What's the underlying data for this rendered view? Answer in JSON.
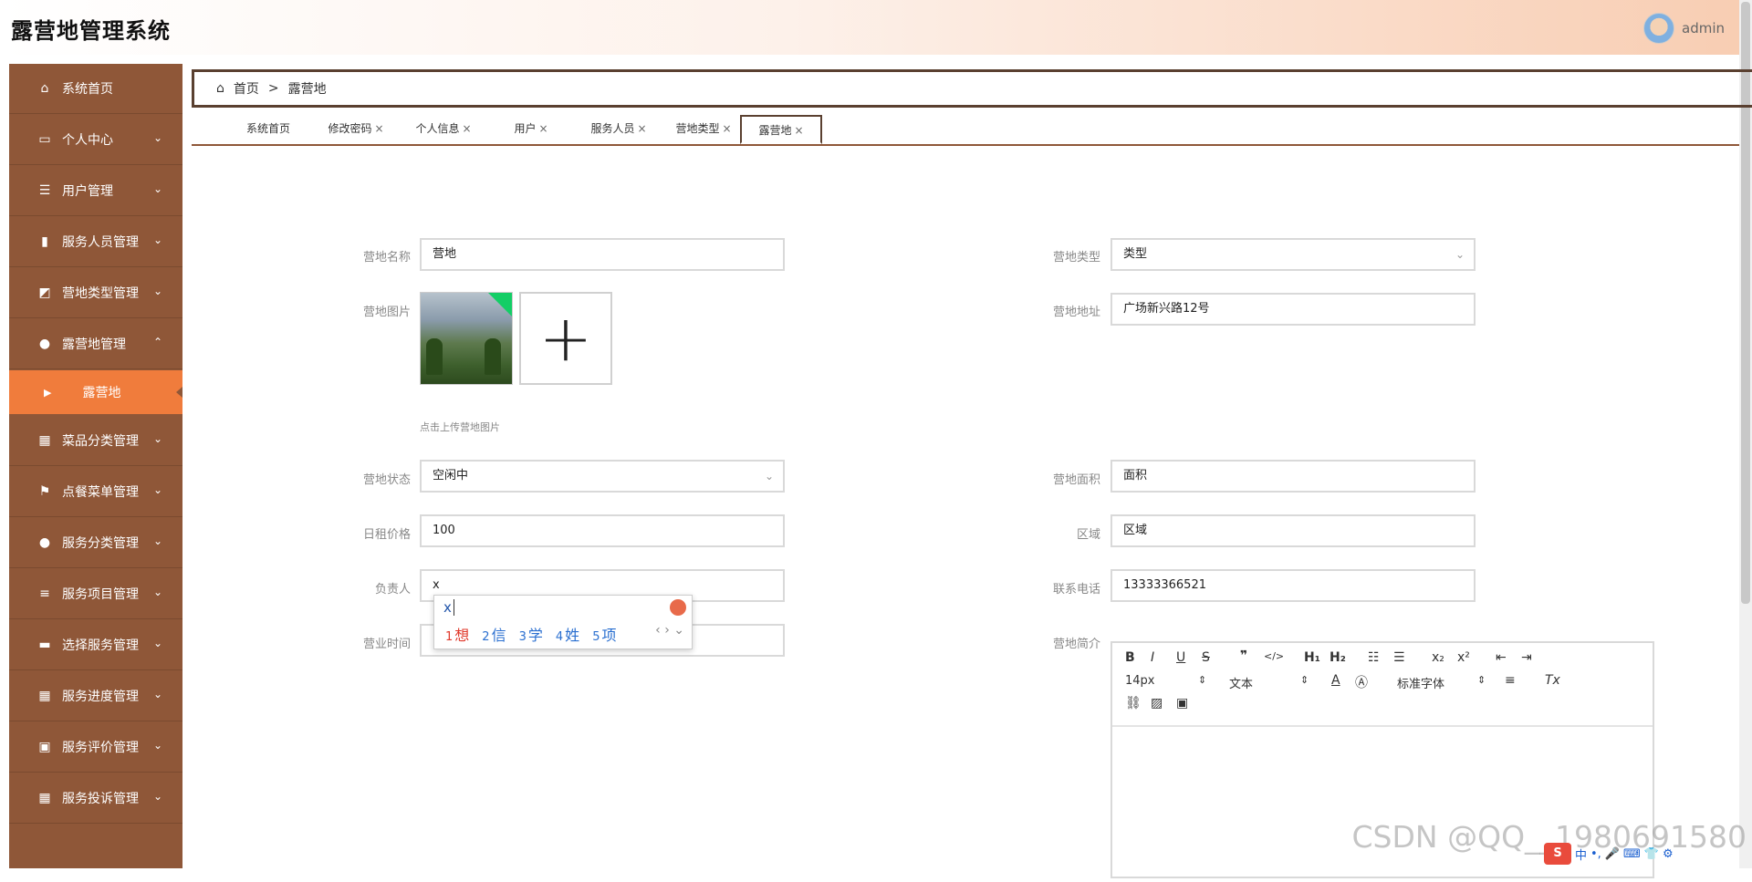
{
  "app": {
    "title": "露营地管理系统",
    "username": "admin"
  },
  "sidebar": {
    "items": [
      {
        "label": "系统首页",
        "icon": "home-icon",
        "glyph": "⌂",
        "expandable": false
      },
      {
        "label": "个人中心",
        "icon": "id-card-icon",
        "glyph": "▭",
        "expandable": true
      },
      {
        "label": "用户管理",
        "icon": "sliders-icon",
        "glyph": "☰",
        "expandable": true
      },
      {
        "label": "服务人员管理",
        "icon": "bar-chart-icon",
        "glyph": "▮",
        "expandable": true
      },
      {
        "label": "营地类型管理",
        "icon": "line-chart-icon",
        "glyph": "◩",
        "expandable": true
      },
      {
        "label": "露营地管理",
        "icon": "user-icon",
        "glyph": "●",
        "expandable": true,
        "expanded": true
      },
      {
        "label": "菜品分类管理",
        "icon": "grid-icon",
        "glyph": "▦",
        "expandable": true
      },
      {
        "label": "点餐菜单管理",
        "icon": "flag-icon",
        "glyph": "⚑",
        "expandable": true
      },
      {
        "label": "服务分类管理",
        "icon": "bulb-icon",
        "glyph": "●",
        "expandable": true
      },
      {
        "label": "服务项目管理",
        "icon": "list-icon",
        "glyph": "≡",
        "expandable": true
      },
      {
        "label": "选择服务管理",
        "icon": "chat-icon",
        "glyph": "▬",
        "expandable": true
      },
      {
        "label": "服务进度管理",
        "icon": "grid-icon",
        "glyph": "▦",
        "expandable": true
      },
      {
        "label": "服务评价管理",
        "icon": "clipboard-check-icon",
        "glyph": "▣",
        "expandable": true
      },
      {
        "label": "服务投诉管理",
        "icon": "grid-icon",
        "glyph": "▦",
        "expandable": true
      }
    ],
    "subitem": "露营地"
  },
  "breadcrumb": {
    "home": "首页",
    "sep": ">",
    "current": "露营地"
  },
  "tabs": [
    {
      "label": "系统首页",
      "closable": false
    },
    {
      "label": "修改密码",
      "closable": true
    },
    {
      "label": "个人信息",
      "closable": true
    },
    {
      "label": "用户",
      "closable": true
    },
    {
      "label": "服务人员",
      "closable": true
    },
    {
      "label": "营地类型",
      "closable": true
    },
    {
      "label": "露营地",
      "closable": true,
      "active": true
    }
  ],
  "form": {
    "name_label": "营地名称",
    "name_value": "营地",
    "type_label": "营地类型",
    "type_value": "类型",
    "image_label": "营地图片",
    "image_hint": "点击上传营地图片",
    "address_label": "营地地址",
    "address_value": "广场新兴路12号",
    "status_label": "营地状态",
    "status_value": "空闲中",
    "area_label": "营地面积",
    "area_value": "面积",
    "price_label": "日租价格",
    "price_value": "100",
    "region_label": "区域",
    "region_value": "区域",
    "manager_label": "负责人",
    "manager_value": "x",
    "phone_label": "联系电话",
    "phone_value": "13333366521",
    "hours_label": "营业时间",
    "intro_label": "营地简介"
  },
  "ime": {
    "input": "x",
    "candidates": [
      {
        "n": "1",
        "c": "想"
      },
      {
        "n": "2",
        "c": "信"
      },
      {
        "n": "3",
        "c": "学"
      },
      {
        "n": "4",
        "c": "姓"
      },
      {
        "n": "5",
        "c": "项"
      }
    ],
    "nav": "‹ › ⌄"
  },
  "editor": {
    "font_size": "14px",
    "paragraph": "文本",
    "font_family": "标准字体"
  },
  "watermark": "CSDN @QQ__1980691580",
  "tray": {
    "lang": "中"
  },
  "colors": {
    "sidebar": "#8f5738",
    "active_item": "#f07c3c",
    "accent_green": "#13ce66"
  }
}
